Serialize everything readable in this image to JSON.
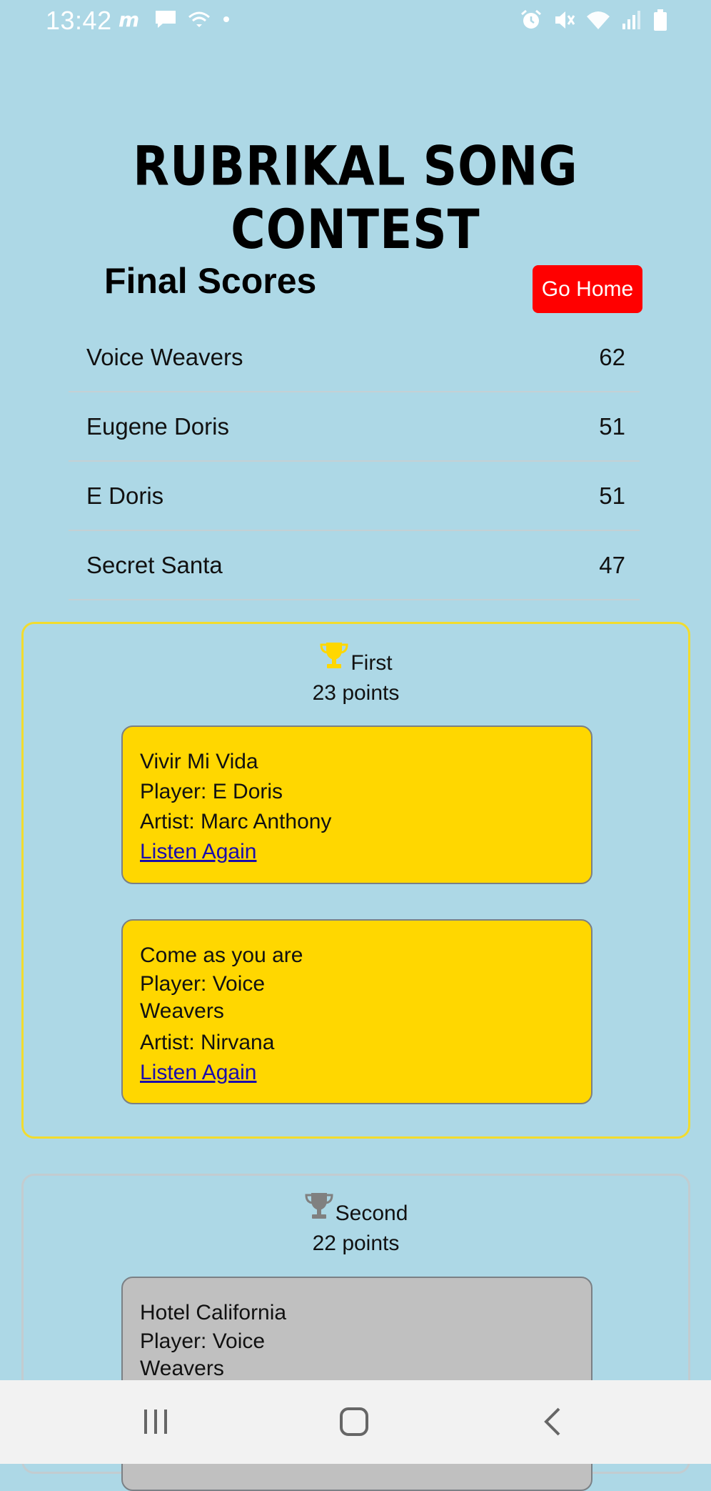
{
  "status_bar": {
    "time": "13:42",
    "left_icons": [
      "messenger-icon",
      "chat-icon",
      "wifi-calling-icon",
      "dot-icon"
    ],
    "right_icons": [
      "alarm-icon",
      "mute-icon",
      "wifi-icon",
      "signal-icon",
      "battery-icon"
    ]
  },
  "app": {
    "title": "RUBRIKAL SONG CONTEST"
  },
  "header": {
    "heading": "Final Scores",
    "go_home_label": "Go Home"
  },
  "scores": [
    {
      "name": "Voice Weavers",
      "score": "62"
    },
    {
      "name": "Eugene Doris",
      "score": "51"
    },
    {
      "name": "E Doris",
      "score": "51"
    },
    {
      "name": "Secret Santa",
      "score": "47"
    }
  ],
  "places": [
    {
      "rank": "First",
      "points": "23 points",
      "trophy_color": "#ffd700",
      "card_color": "#ffd700",
      "songs": [
        {
          "title": "Vivir Mi Vida",
          "player": "Player: E Doris",
          "artist": "Artist: Marc Anthony",
          "link": "Listen Again"
        },
        {
          "title": "Come as you are",
          "player": "Player: Voice Weavers",
          "artist": "Artist: Nirvana",
          "link": "Listen Again"
        }
      ]
    },
    {
      "rank": "Second",
      "points": "22 points",
      "trophy_color": "#808080",
      "card_color": "#c0c0c0",
      "songs": [
        {
          "title": "Hotel California",
          "player": "Player: Voice Weavers"
        }
      ]
    }
  ],
  "nav_bar": {
    "buttons": [
      "recent-apps-icon",
      "home-icon",
      "back-icon"
    ]
  }
}
